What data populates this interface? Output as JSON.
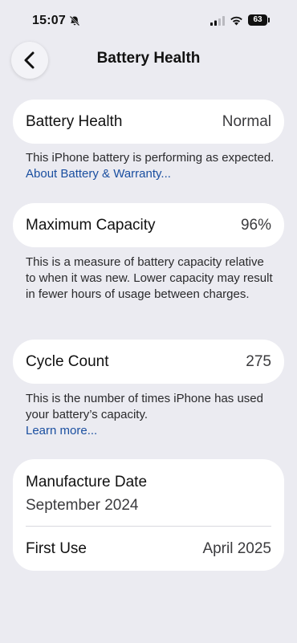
{
  "status_bar": {
    "time": "15:07",
    "battery_level": "63"
  },
  "nav": {
    "title": "Battery Health"
  },
  "battery_health": {
    "label": "Battery Health",
    "value": "Normal",
    "description": "This iPhone battery is performing as expected.",
    "link": "About Battery & Warranty..."
  },
  "maximum_capacity": {
    "label": "Maximum Capacity",
    "value": "96%",
    "description": "This is a measure of battery capacity relative to when it was new. Lower capacity may result in fewer hours of usage between charges."
  },
  "cycle_count": {
    "label": "Cycle Count",
    "value": "275",
    "description": "This is the number of times iPhone has used your battery’s capacity.",
    "link": "Learn more..."
  },
  "dates": {
    "manufacture_label": "Manufacture Date",
    "manufacture_value": "September 2024",
    "first_use_label": "First Use",
    "first_use_value": "April 2025"
  },
  "colors": {
    "background": "#ebebf1",
    "card": "#ffffff",
    "link": "#1a4fa0"
  }
}
